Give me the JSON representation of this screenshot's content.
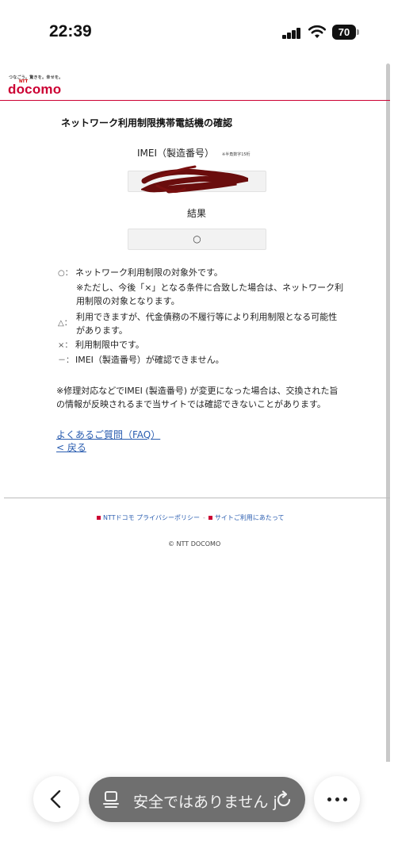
{
  "status_bar": {
    "time": "22:39",
    "battery": "70"
  },
  "header": {
    "tagline": "つなごう。驚きを。幸せを。",
    "logo_ntt": "NTT",
    "logo": "docomo"
  },
  "main": {
    "title": "ネットワーク利用制限携帯電話機の確認",
    "imei_label": "IMEI（製造番号）",
    "imei_note": "※半角数字15桁",
    "result_label": "結果",
    "result_value": "○"
  },
  "legend": [
    {
      "mark": "○：",
      "text": "ネットワーク利用制限の対象外です。"
    },
    {
      "mark": "△：",
      "text": "利用できますが、代金債務の不履行等により利用制限となる可能性があります。"
    },
    {
      "mark": "×：",
      "text": "利用制限中です。"
    },
    {
      "mark": "－：",
      "text": "IMEI（製造番号）が確認できません。"
    }
  ],
  "legend_sub": "※ただし、今後「×」となる条件に合致した場合は、ネットワーク利用制限の対象となります。",
  "repair_note": "※修理対応などでIMEI (製造番号) が変更になった場合は、交換された旨の情報が反映されるまで当サイトでは確認できないことがあります。",
  "links": {
    "faq": "よくあるご質問（FAQ）",
    "back": "< 戻る"
  },
  "footer": {
    "privacy": "NTTドコモ プライバシーポリシー",
    "terms": "サイトご利用にあたって",
    "copyright": "© NTT DOCOMO"
  },
  "browser": {
    "url_text": "安全ではありません jp"
  }
}
